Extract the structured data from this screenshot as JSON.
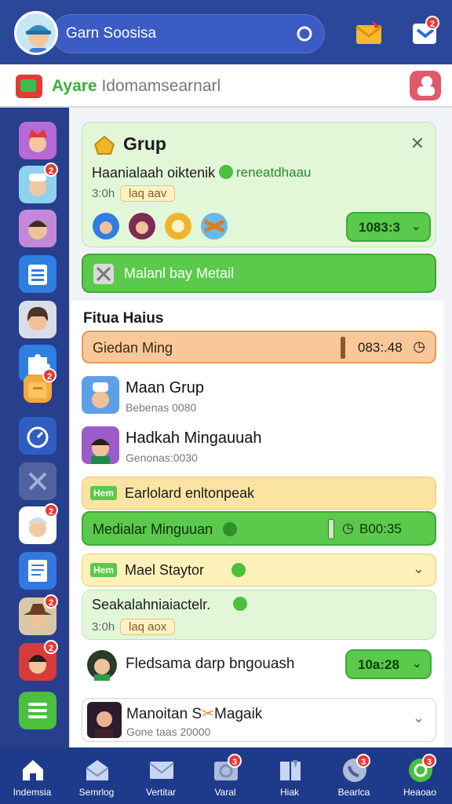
{
  "header": {
    "search_text": "Garn Soosisa",
    "sub_title_prefix": "Ayare",
    "sub_title_rest": " Idomamsearnarl"
  },
  "group_card": {
    "title": "Grup",
    "line": "Haanialaah oiktenik",
    "status": "reneatdhaau",
    "time": "3:0h",
    "tag": "laq aav",
    "button": "1083:3"
  },
  "main_button": "Malanl bay Metail",
  "section_title": "Fitua Haius",
  "orange_bar": {
    "label": "Giedan Ming",
    "time": "083:.48"
  },
  "list": [
    {
      "name": "Maan Grup",
      "sub": "Bebenas 0080"
    },
    {
      "name": "Hadkah Mingauuah",
      "sub": "Genonas:0030"
    }
  ],
  "yellow_bar": {
    "tag": "Hem",
    "label": "Earlolard enltonpeak"
  },
  "green_bar": {
    "label": "Medialar Minguuan",
    "time": "B00:35"
  },
  "yellow_bar2": {
    "tag": "Hem",
    "label": "Mael Staytor"
  },
  "light_card": {
    "line": "Seakalahniaiactelr.",
    "time": "3:0h",
    "tag": "laq aox"
  },
  "fried_row": {
    "name": "Fledsama darp bngouash",
    "button": "10a:28"
  },
  "last_card": {
    "name": "Manoitan S",
    "name2": "Magaik",
    "sub": "Gone taas 20000"
  },
  "nav": [
    {
      "label": "Indemsia",
      "icon": "home-icon"
    },
    {
      "label": "Semrlog",
      "icon": "mail-open-icon"
    },
    {
      "label": "Vertitar",
      "icon": "mail-icon"
    },
    {
      "label": "Varal",
      "icon": "folder-icon"
    },
    {
      "label": "Hiak",
      "icon": "book-icon"
    },
    {
      "label": "Bearlca",
      "icon": "phone-icon"
    },
    {
      "label": "Heaoao",
      "icon": "settings-icon"
    }
  ],
  "badges": {
    "top": "2",
    "side": "2",
    "nav": "3"
  },
  "colors": {
    "primary": "#2b4799",
    "accent_green": "#5bc94b",
    "badge": "#e53935"
  }
}
